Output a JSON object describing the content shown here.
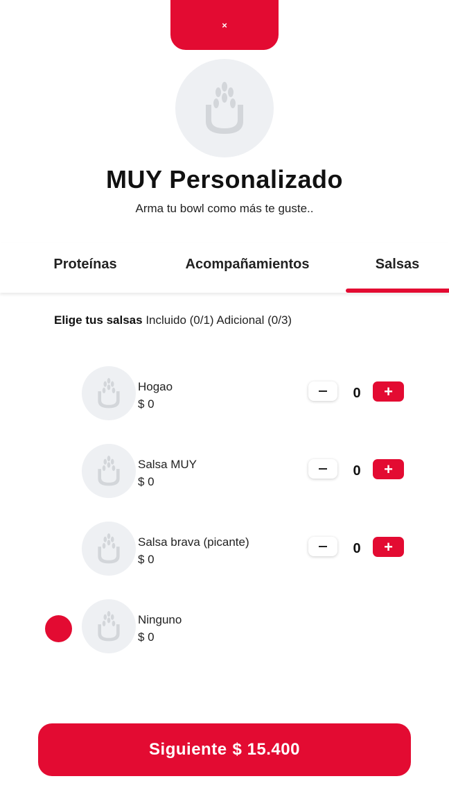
{
  "header": {
    "close_label": "×",
    "title": "MUY Personalizado",
    "subtitle": "Arma tu bowl como más te guste.."
  },
  "tabs": [
    {
      "label": "Proteínas",
      "active": false
    },
    {
      "label": "Acompañamientos",
      "active": false
    },
    {
      "label": "Salsas",
      "active": true
    }
  ],
  "section": {
    "title": "Elige tus salsas",
    "included": "Incluido (0/1)",
    "additional": "Adicional (0/3)"
  },
  "items": [
    {
      "name": "Hogao",
      "price": "$ 0",
      "qty": "0"
    },
    {
      "name": "Salsa MUY",
      "price": "$ 0",
      "qty": "0"
    },
    {
      "name": "Salsa brava (picante)",
      "price": "$ 0",
      "qty": "0"
    },
    {
      "name": "Ninguno",
      "price": "$ 0",
      "selected": true
    }
  ],
  "footer": {
    "next_label": "Siguiente",
    "total": "$ 15.400"
  },
  "colors": {
    "accent": "#e30b32",
    "placeholder_bg": "#eef0f3"
  },
  "icons": {
    "logo": "bowl-logo-icon",
    "minus": "minus-icon",
    "plus": "plus-icon"
  }
}
